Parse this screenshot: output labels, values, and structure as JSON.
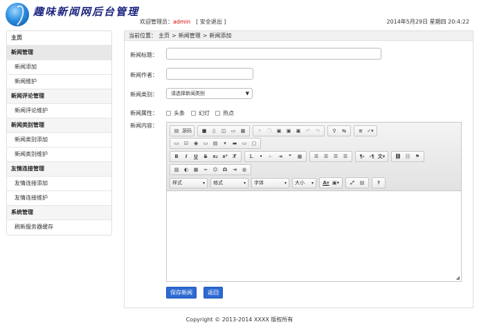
{
  "header": {
    "app_title": "趣味新闻网后台管理",
    "welcome_label": "欢迎管理员：",
    "username": "admin",
    "logout": "[ 安全退出 ]",
    "datetime": "2014年5月29日 星期四 20:4:22"
  },
  "sidebar": {
    "home": "主页",
    "sections": [
      {
        "title": "新闻管理",
        "items": [
          "新闻添加",
          "新闻维护"
        ]
      },
      {
        "title": "新闻评论管理",
        "items": [
          "新闻评论维护"
        ]
      },
      {
        "title": "新闻类别管理",
        "items": [
          "新闻类别添加",
          "新闻类别维护"
        ]
      },
      {
        "title": "友情连接管理",
        "items": [
          "友情连接添加",
          "友情连接维护"
        ]
      },
      {
        "title": "系统管理",
        "items": [
          "刷新服务器缓存"
        ]
      }
    ]
  },
  "breadcrumb": {
    "prefix": "当前位置：",
    "items": [
      "主页",
      ">",
      "新闻管理",
      ">",
      "新闻添加"
    ]
  },
  "form": {
    "title_label": "新闻标题：",
    "title_value": "",
    "author_label": "新闻作者：",
    "author_value": "",
    "type_label": "新闻类别：",
    "type_selected": "请选择新闻类别",
    "attr_label": "新闻属性：",
    "attrs": [
      "头条",
      "幻灯",
      "热点"
    ],
    "content_label": "新闻内容：",
    "save_button": "保存新闻",
    "back_button": "返回"
  },
  "editor": {
    "source_label": "源码",
    "style_combo": "样式",
    "format_combo": "格式",
    "font_combo": "字体",
    "size_combo": "大小",
    "help": "?"
  },
  "footer": {
    "copyright": "Copyright © 2013-2014 XXXX 版权所有"
  }
}
